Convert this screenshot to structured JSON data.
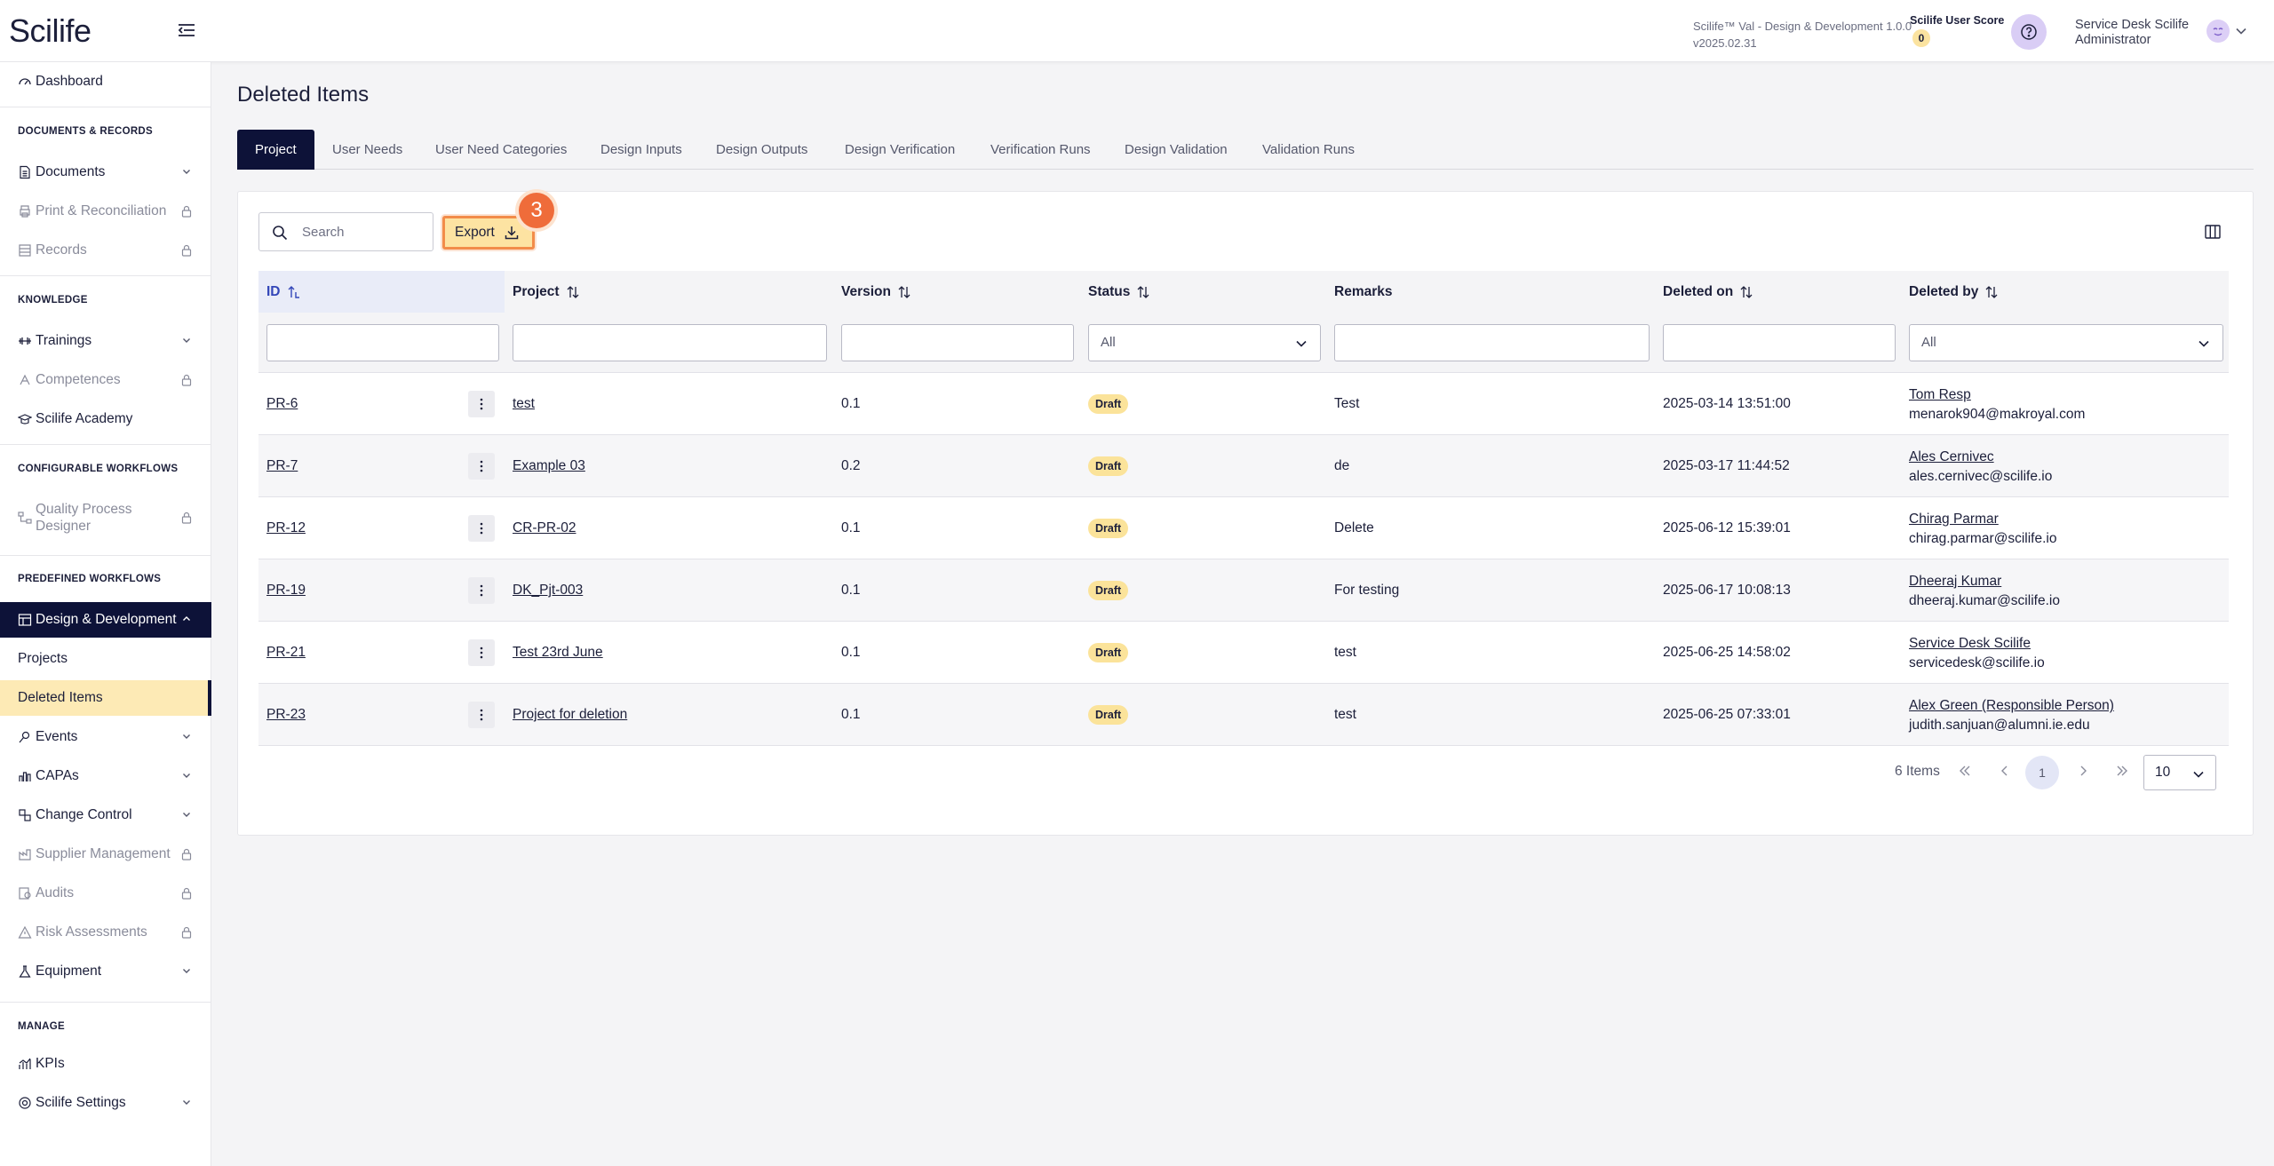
{
  "app": {
    "logo": "Scilife"
  },
  "header": {
    "version_line1": "Scilife™ Val - Design & Development 1.0.0",
    "version_line2": "v2025.02.31",
    "score_label": "Scilife User Score",
    "score_value": "0",
    "user_line1": "Service Desk Scilife",
    "user_line2": "Administrator",
    "icons": [
      "menu-collapse-icon",
      "help-icon",
      "avatar-icon",
      "chevron-down-icon"
    ]
  },
  "sidebar": {
    "dashboard": "Dashboard",
    "sections": {
      "docs": "DOCUMENTS & RECORDS",
      "knowledge": "KNOWLEDGE",
      "configurable": "CONFIGURABLE WORKFLOWS",
      "predefined": "PREDEFINED WORKFLOWS",
      "manage": "MANAGE"
    },
    "items": {
      "documents": "Documents",
      "print": "Print & Reconciliation",
      "records": "Records",
      "trainings": "Trainings",
      "competences": "Competences",
      "academy": "Scilife Academy",
      "qpd_1": "Quality Process",
      "qpd_2": "Designer",
      "dd": "Design & Development",
      "projects": "Projects",
      "deleted": "Deleted Items",
      "events": "Events",
      "capas": "CAPAs",
      "change": "Change Control",
      "supplier": "Supplier Management",
      "audits": "Audits",
      "risk": "Risk Assessments",
      "equipment": "Equipment",
      "kpis": "KPIs",
      "settings": "Scilife Settings"
    }
  },
  "page": {
    "title": "Deleted Items"
  },
  "tabs": [
    "Project",
    "User Needs",
    "User Need Categories",
    "Design Inputs",
    "Design Outputs",
    "Design Verification",
    "Verification Runs",
    "Design Validation",
    "Validation Runs"
  ],
  "toolbar": {
    "search_placeholder": "Search",
    "export_label": "Export",
    "step_marker": "3"
  },
  "table": {
    "columns": [
      "ID",
      "Project",
      "Version",
      "Status",
      "Remarks",
      "Deleted on",
      "Deleted by"
    ],
    "filters": {
      "status": "All",
      "deleted_by": "All"
    },
    "rows": [
      {
        "id": "PR-6",
        "project": "test",
        "version": "0.1",
        "status": "Draft",
        "remarks": "Test",
        "deleted_on": "2025-03-14 13:51:00",
        "by_name": "Tom Resp",
        "by_email": "menarok904@makroyal.com"
      },
      {
        "id": "PR-7",
        "project": "Example 03",
        "version": "0.2",
        "status": "Draft",
        "remarks": "de",
        "deleted_on": "2025-03-17 11:44:52",
        "by_name": "Ales Cernivec",
        "by_email": "ales.cernivec@scilife.io"
      },
      {
        "id": "PR-12",
        "project": "CR-PR-02",
        "version": "0.1",
        "status": "Draft",
        "remarks": "Delete",
        "deleted_on": "2025-06-12 15:39:01",
        "by_name": "Chirag Parmar",
        "by_email": "chirag.parmar@scilife.io"
      },
      {
        "id": "PR-19",
        "project": "DK_Pjt-003",
        "version": "0.1",
        "status": "Draft",
        "remarks": "For testing",
        "deleted_on": "2025-06-17 10:08:13",
        "by_name": "Dheeraj Kumar",
        "by_email": "dheeraj.kumar@scilife.io"
      },
      {
        "id": "PR-21",
        "project": "Test 23rd June",
        "version": "0.1",
        "status": "Draft",
        "remarks": "test",
        "deleted_on": "2025-06-25 14:58:02",
        "by_name": "Service Desk Scilife",
        "by_email": "servicedesk@scilife.io"
      },
      {
        "id": "PR-23",
        "project": "Project for deletion",
        "version": "0.1",
        "status": "Draft",
        "remarks": "test",
        "deleted_on": "2025-06-25 07:33:01",
        "by_name": "Alex Green (Responsible Person)",
        "by_email": "judith.sanjuan@alumni.ie.edu"
      }
    ]
  },
  "pagination": {
    "total": "6 Items",
    "current_page": "1",
    "page_size": "10"
  },
  "colors": {
    "navy": "#0d1238",
    "accent_yellow": "#fde3a2",
    "highlight_orange": "#ef6c3a",
    "draft_badge": "#fbe39a"
  }
}
